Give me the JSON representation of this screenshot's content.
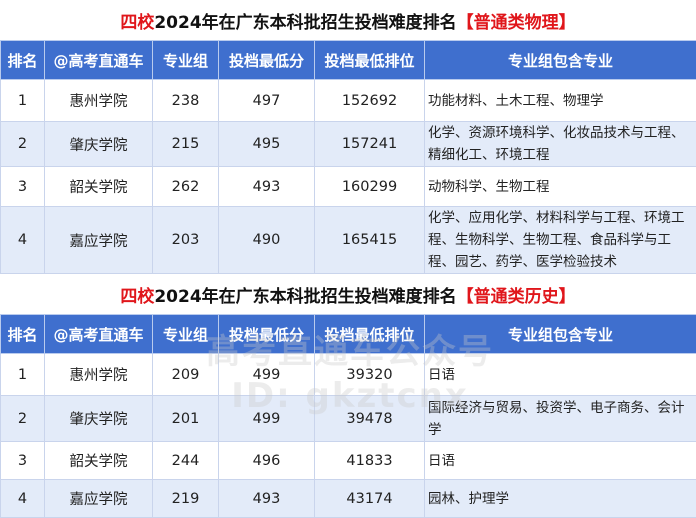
{
  "physics": {
    "title_prefix": "四校",
    "title_main": "2024年在广东本科批招生投档难度排名",
    "title_tag": "【普通类物理】",
    "headers": [
      "排名",
      "@高考直通车",
      "专业组",
      "投档最低分",
      "投档最低排位",
      "专业组包含专业"
    ],
    "rows": [
      {
        "rank": "1",
        "school": "惠州学院",
        "group": "238",
        "score": "497",
        "position": "152692",
        "majors": "功能材料、土木工程、物理学"
      },
      {
        "rank": "2",
        "school": "肇庆学院",
        "group": "215",
        "score": "495",
        "position": "157241",
        "majors": "化学、资源环境科学、化妆品技术与工程、精细化工、环境工程"
      },
      {
        "rank": "3",
        "school": "韶关学院",
        "group": "262",
        "score": "493",
        "position": "160299",
        "majors": "动物科学、生物工程"
      },
      {
        "rank": "4",
        "school": "嘉应学院",
        "group": "203",
        "score": "490",
        "position": "165415",
        "majors": "化学、应用化学、材料科学与工程、环境工程、生物科学、生物工程、食品科学与工程、园艺、药学、医学检验技术"
      }
    ]
  },
  "history": {
    "title_prefix": "四校",
    "title_main": "2024年在广东本科批招生投档难度排名",
    "title_tag": "【普通类历史】",
    "headers": [
      "排名",
      "@高考直通车",
      "专业组",
      "投档最低分",
      "投档最低排位",
      "专业组包含专业"
    ],
    "rows": [
      {
        "rank": "1",
        "school": "惠州学院",
        "group": "209",
        "score": "499",
        "position": "39320",
        "majors": "日语"
      },
      {
        "rank": "2",
        "school": "肇庆学院",
        "group": "201",
        "score": "499",
        "position": "39478",
        "majors": "国际经济与贸易、投资学、电子商务、会计学"
      },
      {
        "rank": "3",
        "school": "韶关学院",
        "group": "244",
        "score": "496",
        "position": "41833",
        "majors": "日语"
      },
      {
        "rank": "4",
        "school": "嘉应学院",
        "group": "219",
        "score": "493",
        "position": "43174",
        "majors": "园林、护理学"
      }
    ]
  },
  "watermark": {
    "line1": "高考直通车公众号",
    "line2": "ID: gkztcnx"
  }
}
